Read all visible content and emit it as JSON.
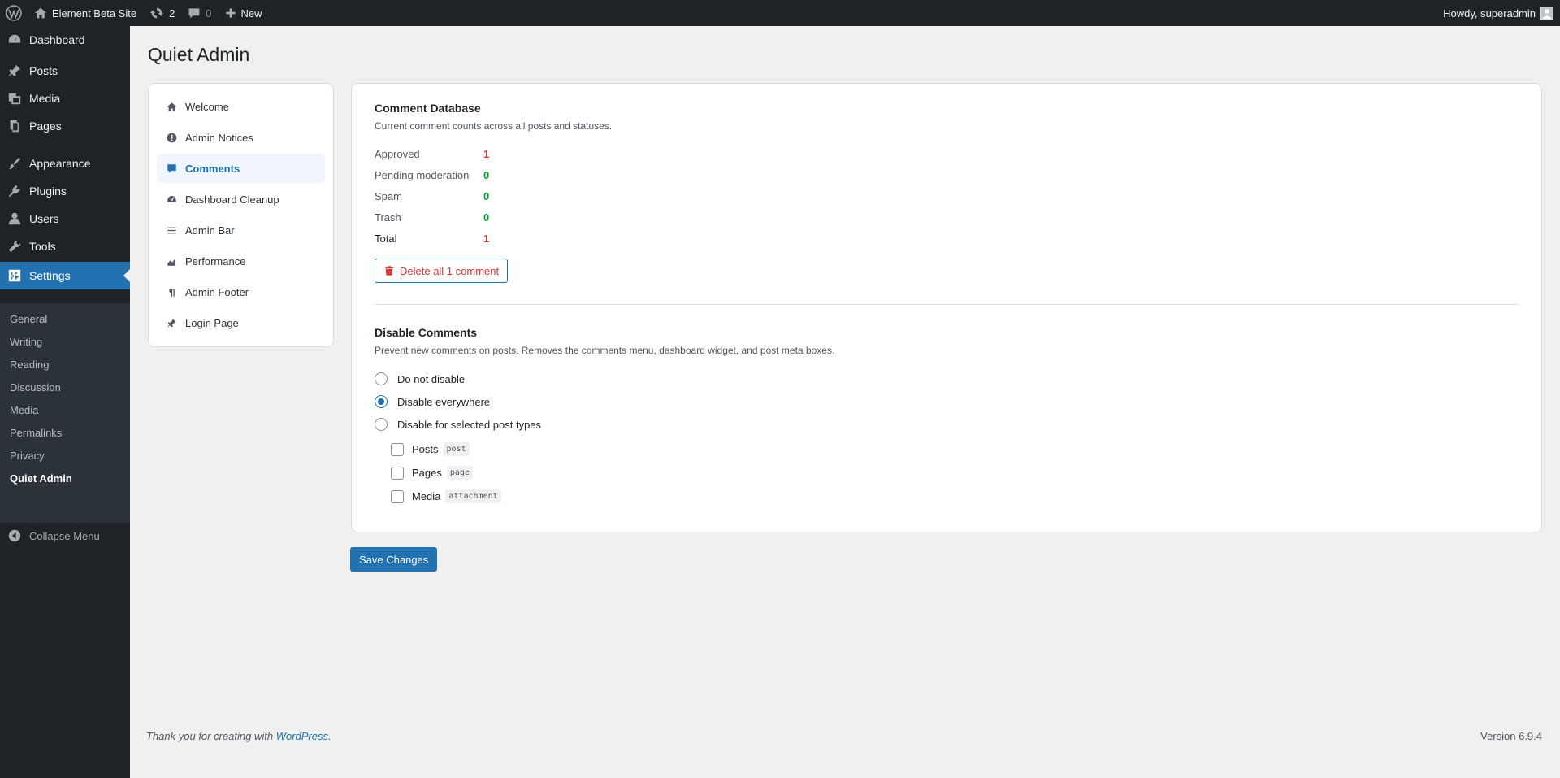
{
  "admin_bar": {
    "site_name": "Element Beta Site",
    "updates_count": "2",
    "comments_count": "0",
    "new_label": "New",
    "greeting": "Howdy, superadmin"
  },
  "sidebar": {
    "items": [
      {
        "label": "Dashboard",
        "icon": "dashboard-icon"
      },
      {
        "label": "Posts",
        "icon": "pin-icon"
      },
      {
        "label": "Media",
        "icon": "media-icon"
      },
      {
        "label": "Pages",
        "icon": "pages-icon"
      },
      {
        "label": "Appearance",
        "icon": "brush-icon"
      },
      {
        "label": "Plugins",
        "icon": "plugin-icon"
      },
      {
        "label": "Users",
        "icon": "user-icon"
      },
      {
        "label": "Tools",
        "icon": "wrench-icon"
      },
      {
        "label": "Settings",
        "icon": "settings-icon"
      }
    ],
    "submenu": [
      "General",
      "Writing",
      "Reading",
      "Discussion",
      "Media",
      "Permalinks",
      "Privacy",
      "Quiet Admin"
    ],
    "collapse_label": "Collapse Menu"
  },
  "page": {
    "title": "Quiet Admin"
  },
  "plugin_nav": {
    "items": [
      {
        "label": "Welcome",
        "icon": "home-icon"
      },
      {
        "label": "Admin Notices",
        "icon": "warning-icon"
      },
      {
        "label": "Comments",
        "icon": "comment-icon"
      },
      {
        "label": "Dashboard Cleanup",
        "icon": "dashboard-icon"
      },
      {
        "label": "Admin Bar",
        "icon": "menu-icon"
      },
      {
        "label": "Performance",
        "icon": "chart-area-icon"
      },
      {
        "label": "Admin Footer",
        "icon": "paragraph-icon"
      },
      {
        "label": "Login Page",
        "icon": "pin-icon"
      }
    ],
    "active": "Comments"
  },
  "comment_db": {
    "title": "Comment Database",
    "description": "Current comment counts across all posts and statuses.",
    "stats": [
      {
        "label": "Approved",
        "value": "1",
        "color": "#d63638"
      },
      {
        "label": "Pending moderation",
        "value": "0",
        "color": "#00a32a"
      },
      {
        "label": "Spam",
        "value": "0",
        "color": "#00a32a"
      },
      {
        "label": "Trash",
        "value": "0",
        "color": "#00a32a"
      },
      {
        "label": "Total",
        "value": "1",
        "color": "#d63638"
      }
    ],
    "delete_label": "Delete all 1 comment"
  },
  "disable_comments": {
    "title": "Disable Comments",
    "description": "Prevent new comments on posts. Removes the comments menu, dashboard widget, and post meta boxes.",
    "options": [
      "Do not disable",
      "Disable everywhere",
      "Disable for selected post types"
    ],
    "selected": "Disable everywhere",
    "post_types": [
      {
        "label": "Posts",
        "slug": "post",
        "checked": false
      },
      {
        "label": "Pages",
        "slug": "page",
        "checked": false
      },
      {
        "label": "Media",
        "slug": "attachment",
        "checked": false
      }
    ]
  },
  "save_label": "Save Changes",
  "footer": {
    "thanks_prefix": "Thank you for creating with ",
    "thanks_link": "WordPress",
    "thanks_suffix": ".",
    "version": "Version 6.9.4"
  },
  "colors": {
    "admin_bar_bg": "#1d2327",
    "accent": "#2271b1",
    "danger": "#d63638",
    "success": "#00a32a"
  }
}
